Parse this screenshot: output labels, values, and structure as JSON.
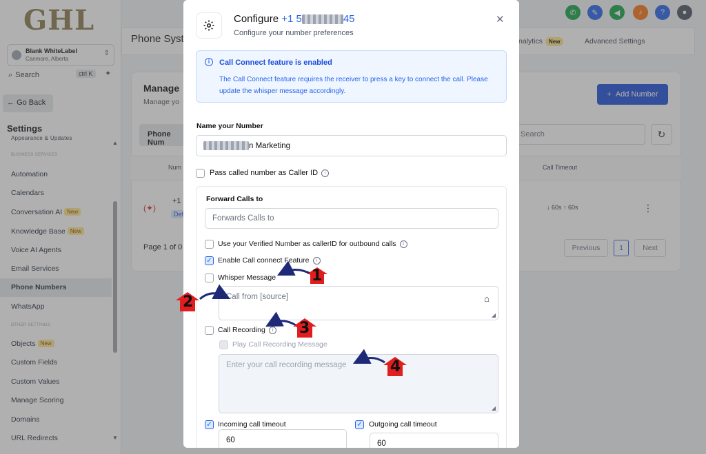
{
  "brand": {
    "logo_text": "GHL"
  },
  "account": {
    "name": "Blank WhiteLabel",
    "location": "Canmore, Alberta"
  },
  "sidebar": {
    "search_label": "Search",
    "search_shortcut": "ctrl K",
    "go_back": "Go Back",
    "title": "Settings",
    "cut_item": "Appearance & Updates",
    "section_business": "BUSINESS SERVICES",
    "section_other": "OTHER SETTINGS",
    "items": [
      {
        "label": "Automation",
        "new": ""
      },
      {
        "label": "Calendars",
        "new": ""
      },
      {
        "label": "Conversation AI",
        "new": "New"
      },
      {
        "label": "Knowledge Base",
        "new": "New"
      },
      {
        "label": "Voice AI Agents",
        "new": ""
      },
      {
        "label": "Email Services",
        "new": ""
      },
      {
        "label": "Phone Numbers",
        "new": ""
      },
      {
        "label": "WhatsApp",
        "new": ""
      }
    ],
    "other_items": [
      {
        "label": "Objects",
        "new": "New"
      },
      {
        "label": "Custom Fields",
        "new": ""
      },
      {
        "label": "Custom Values",
        "new": ""
      },
      {
        "label": "Manage Scoring",
        "new": ""
      },
      {
        "label": "Domains",
        "new": ""
      },
      {
        "label": "URL Redirects",
        "new": ""
      }
    ],
    "active": "Phone Numbers"
  },
  "background": {
    "page_title": "Phone Syst",
    "tabs": {
      "analytics": "nalytics",
      "analytics_badge": "New",
      "advanced": "Advanced Settings"
    },
    "card_title": "Manage",
    "card_sub": "Manage yo",
    "add_number": "Add Number",
    "tab_phone": "Phone Num",
    "search_placeholder": "Search",
    "col_number": "Num",
    "col_timeout": "Call Timeout",
    "row_number": "+1 5",
    "row_badge": "Def",
    "row_timeouts": "↓ 60s   ↑ 60s",
    "pagination_text": "Page 1 of 0",
    "prev": "Previous",
    "page": "1",
    "next": "Next"
  },
  "modal": {
    "title_prefix": "Configure",
    "number_start": "+1 5",
    "number_end": "45",
    "subtitle": "Configure your number preferences",
    "info": {
      "title": "Call Connect feature is enabled",
      "body": "The Call Connect feature requires the receiver to press a key to connect the call. Please update the whisper message accordingly."
    },
    "name_label": "Name your Number",
    "name_value_suffix": "n Marketing",
    "pass_caller_id": "Pass called number as Caller ID",
    "forward_label": "Forward Calls to",
    "forward_placeholder": "Forwards Calls to",
    "verified_number": "Use your Verified Number as callerID for outbound calls",
    "call_connect": "Enable Call connect Feature",
    "whisper": "Whisper Message",
    "whisper_placeholder": "Call from [source]",
    "call_recording": "Call Recording",
    "play_recording": "Play Call Recording Message",
    "recording_placeholder": "Enter your call recording message",
    "incoming_timeout": "Incoming call timeout",
    "outgoing_timeout": "Outgoing call timeout",
    "incoming_value": "60",
    "outgoing_value": "60"
  },
  "annotations": [
    "1",
    "2",
    "3",
    "4"
  ],
  "colors": {
    "accent": "#2563eb",
    "annotation_red": "#e11d1d",
    "annotation_navy": "#1e2a78"
  }
}
